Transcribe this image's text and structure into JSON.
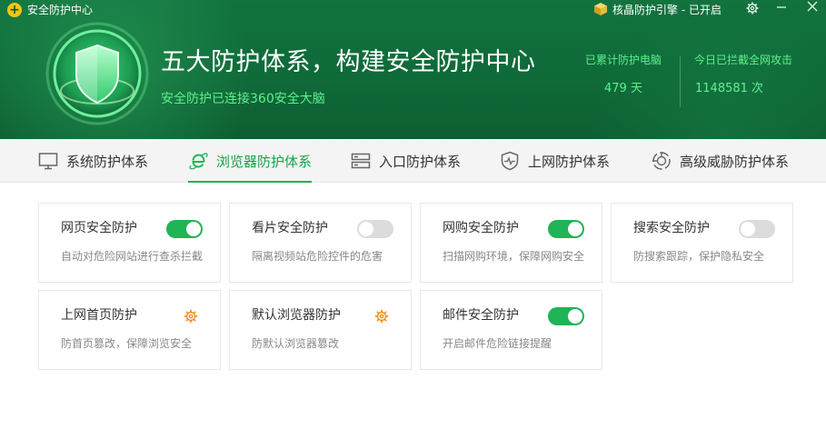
{
  "window": {
    "title": "安全防护中心",
    "engine_label": "核晶防护引擎 - 已开启",
    "logo_glyph": "+"
  },
  "hero": {
    "headline": "五大防护体系，构建安全防护中心",
    "subline": "安全防护已连接360安全大脑",
    "stats": [
      {
        "label": "已累计防护电脑",
        "value": "479 天"
      },
      {
        "label": "今日已拦截全网攻击",
        "value": "1148581 次"
      }
    ]
  },
  "tabs": [
    {
      "label": "系统防护体系",
      "icon": "monitor-icon",
      "active": false
    },
    {
      "label": "浏览器防护体系",
      "icon": "browser-e-icon",
      "active": true
    },
    {
      "label": "入口防护体系",
      "icon": "server-icon",
      "active": false
    },
    {
      "label": "上网防护体系",
      "icon": "shield-pulse-icon",
      "active": false
    },
    {
      "label": "高级威胁防护体系",
      "icon": "radar-icon",
      "active": false
    }
  ],
  "cards": [
    {
      "name": "网页安全防护",
      "desc": "自动对危险网站进行查杀拦截",
      "control": "toggle",
      "enabled": true
    },
    {
      "name": "看片安全防护",
      "desc": "隔离视频站危险控件的危害",
      "control": "toggle",
      "enabled": false
    },
    {
      "name": "网购安全防护",
      "desc": "扫描网购环境，保障网购安全",
      "control": "toggle",
      "enabled": true
    },
    {
      "name": "搜索安全防护",
      "desc": "防搜索跟踪，保护隐私安全",
      "control": "toggle",
      "enabled": false
    },
    {
      "name": "上网首页防护",
      "desc": "防首页篡改，保障浏览安全",
      "control": "settings",
      "enabled": null
    },
    {
      "name": "默认浏览器防护",
      "desc": "防默认浏览器篡改",
      "control": "settings",
      "enabled": null
    },
    {
      "name": "邮件安全防护",
      "desc": "开启邮件危险链接提醒",
      "control": "toggle",
      "enabled": true
    }
  ],
  "colors": {
    "accent_green": "#1fb456",
    "header_green": "#0f6a39",
    "stat_green": "#5ff08e",
    "toggle_off": "#dcdcdc",
    "gear_orange": "#f08a1c"
  }
}
